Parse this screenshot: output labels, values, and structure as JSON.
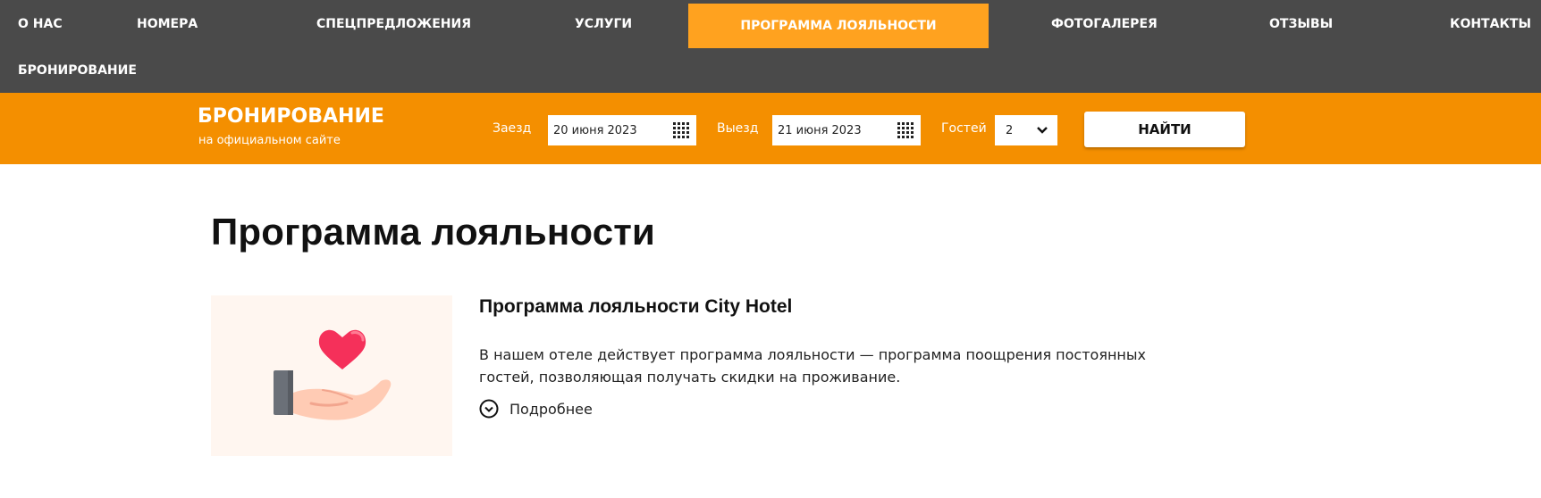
{
  "nav": {
    "items": [
      {
        "label": "О НАС"
      },
      {
        "label": "НОМЕРА"
      },
      {
        "label": "СПЕЦПРЕДЛОЖЕНИЯ"
      },
      {
        "label": "УСЛУГИ"
      },
      {
        "label": "ПРОГРАММА ЛОЯЛЬНОСТИ",
        "active": true
      },
      {
        "label": "ФОТОГАЛЕРЕЯ"
      },
      {
        "label": "ОТЗЫВЫ"
      },
      {
        "label": "КОНТАКТЫ"
      },
      {
        "label": "БРОНИРОВАНИЕ"
      }
    ],
    "active_color": "#ffa21f",
    "background": "#4a4a4a"
  },
  "booking": {
    "title": "БРОНИРОВАНИЕ",
    "subtitle": "на официальном сайте",
    "checkin_label": "Заезд",
    "checkin_value": "20 июня 2023",
    "checkout_label": "Выезд",
    "checkout_value": "21 июня 2023",
    "guests_label": "Гостей",
    "guests_value": "2",
    "search_button": "НАЙТИ",
    "background": "#f48f00"
  },
  "main": {
    "page_title": "Программа лояльности",
    "card": {
      "title": "Программа лояльности City Hotel",
      "description": "В нашем отеле действует программа лояльности — программа поощрения постоянных гостей, позволяющая получать скидки на проживание.",
      "more_label": "Подробнее",
      "image_icon": "heart-in-hand-icon"
    }
  }
}
